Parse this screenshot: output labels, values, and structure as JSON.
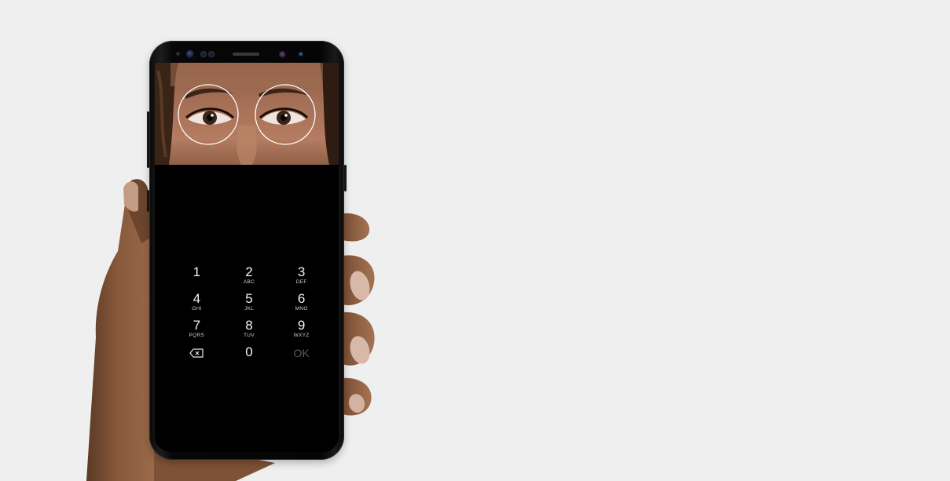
{
  "scene": {
    "background_color": "#efefef",
    "screen_color": "#000000",
    "ring_color": "#ffffff"
  },
  "keypad": {
    "keys": [
      {
        "digit": "1",
        "letters": ""
      },
      {
        "digit": "2",
        "letters": "ABC"
      },
      {
        "digit": "3",
        "letters": "DEF"
      },
      {
        "digit": "4",
        "letters": "GHI"
      },
      {
        "digit": "5",
        "letters": "JKL"
      },
      {
        "digit": "6",
        "letters": "MNO"
      },
      {
        "digit": "7",
        "letters": "PQRS"
      },
      {
        "digit": "8",
        "letters": "TUV"
      },
      {
        "digit": "9",
        "letters": "WXYZ"
      }
    ],
    "backspace_icon": "backspace-icon",
    "zero": "0",
    "ok": "OK"
  }
}
